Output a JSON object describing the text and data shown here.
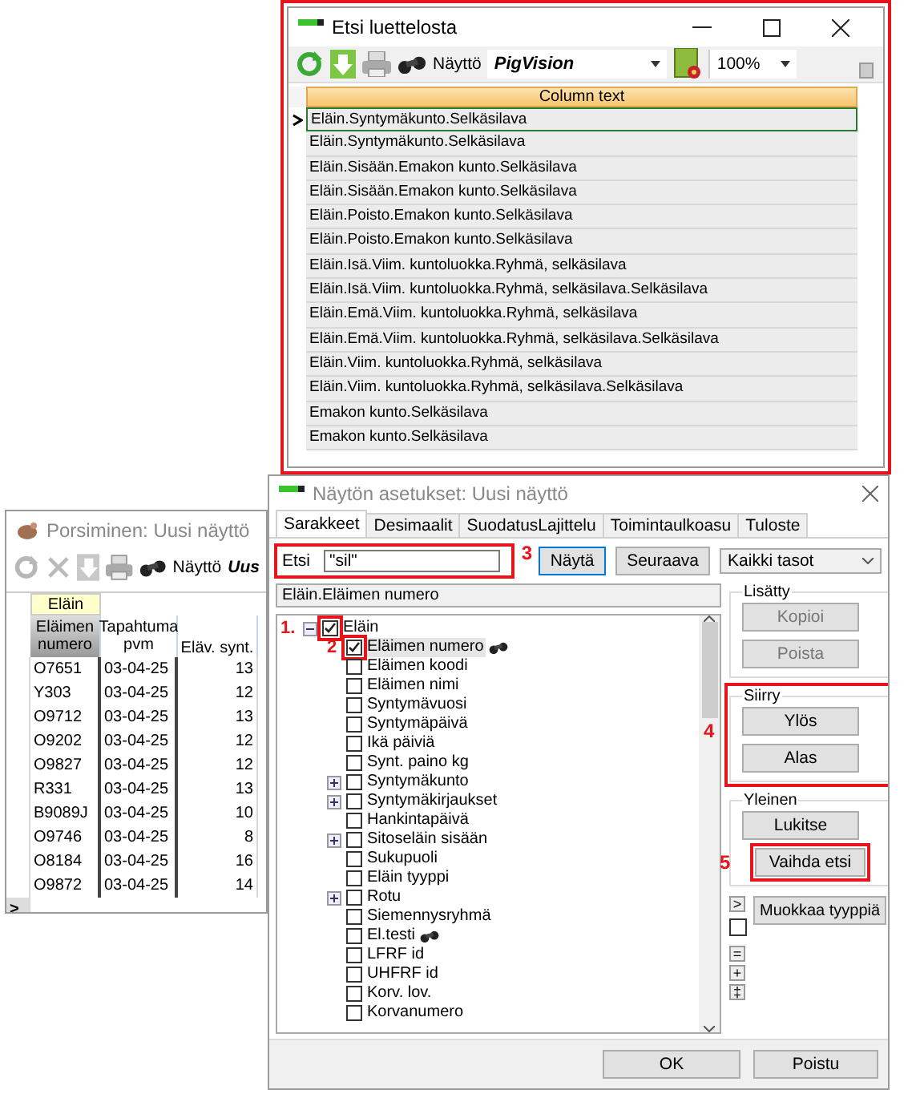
{
  "search_window": {
    "title": "Etsi luettelosta",
    "marked": true,
    "toolbar": {
      "view_label": "Näyttö",
      "view_value": "PigVision",
      "zoom": "100%"
    },
    "grid": {
      "column": "Column text",
      "rows": [
        {
          "text": "Eläin.Syntymäkunto.Selkäsilava",
          "selected": true
        },
        {
          "text": "Eläin.Syntymäkunto.Selkäsilava",
          "selected": false
        },
        {
          "text": "Eläin.Sisään.Emakon kunto.Selkäsilava",
          "selected": false
        },
        {
          "text": "Eläin.Sisään.Emakon kunto.Selkäsilava",
          "selected": false
        },
        {
          "text": "Eläin.Poisto.Emakon kunto.Selkäsilava",
          "selected": false
        },
        {
          "text": "Eläin.Poisto.Emakon kunto.Selkäsilava",
          "selected": false
        },
        {
          "text": "Eläin.Isä.Viim. kuntoluokka.Ryhmä, selkäsilava",
          "selected": false
        },
        {
          "text": "Eläin.Isä.Viim. kuntoluokka.Ryhmä, selkäsilava.Selkäsilava",
          "selected": false
        },
        {
          "text": "Eläin.Emä.Viim. kuntoluokka.Ryhmä, selkäsilava",
          "selected": false
        },
        {
          "text": "Eläin.Emä.Viim. kuntoluokka.Ryhmä, selkäsilava.Selkäsilava",
          "selected": false
        },
        {
          "text": "Eläin.Viim. kuntoluokka.Ryhmä, selkäsilava",
          "selected": false
        },
        {
          "text": "Eläin.Viim. kuntoluokka.Ryhmä, selkäsilava.Selkäsilava",
          "selected": false
        },
        {
          "text": "Emakon kunto.Selkäsilava",
          "selected": false
        },
        {
          "text": "Emakon kunto.Selkäsilava",
          "selected": false
        }
      ]
    }
  },
  "farrowing_window": {
    "title": "Porsiminen: Uusi näyttö",
    "toolbar": {
      "view_label": "Näyttö",
      "view_value": "Uus"
    },
    "group_header": "Eläin",
    "columns": [
      "Eläimen numero",
      "Tapahtuma pvm",
      "Eläv. synt."
    ],
    "rows": [
      [
        "O7651",
        "03-04-25",
        "13"
      ],
      [
        "Y303",
        "03-04-25",
        "12"
      ],
      [
        "O9712",
        "03-04-25",
        "13"
      ],
      [
        "O9202",
        "03-04-25",
        "12"
      ],
      [
        "O9827",
        "03-04-25",
        "12"
      ],
      [
        "R331",
        "03-04-25",
        "13"
      ],
      [
        "B9089J",
        "03-04-25",
        "10"
      ],
      [
        "O9746",
        "03-04-25",
        "8"
      ],
      [
        "O8184",
        "03-04-25",
        "16"
      ],
      [
        "O9872",
        "03-04-25",
        "14"
      ]
    ],
    "new_row_marker": ">"
  },
  "dialog": {
    "title": "Näytön asetukset: Uusi näyttö",
    "tabs": [
      {
        "label": "Sarakkeet",
        "selected": true
      },
      {
        "label": "Desimaalit",
        "selected": false
      },
      {
        "label": "SuodatusLajittelu",
        "selected": false
      },
      {
        "label": "Toimintaulkoasu",
        "selected": false
      },
      {
        "label": "Tuloste",
        "selected": false
      }
    ],
    "search": {
      "label": "Etsi",
      "value": "\"sil\"",
      "marker": "3"
    },
    "show_button": "Näytä",
    "next_button": "Seuraava",
    "level_dropdown": "Kaikki tasot",
    "path": "Eläin.Eläimen numero",
    "tree": [
      {
        "label": "Eläin",
        "checked": true,
        "expanded": true,
        "marker": "1.",
        "children": [
          {
            "label": "Eläimen numero",
            "checked": true,
            "selected": true,
            "flagged": true,
            "marker": "2"
          },
          {
            "label": "Eläimen koodi",
            "checked": false
          },
          {
            "label": "Eläimen nimi",
            "checked": false
          },
          {
            "label": "Syntymävuosi",
            "checked": false
          },
          {
            "label": "Syntymäpäivä",
            "checked": false
          },
          {
            "label": "Ikä päiviä",
            "checked": false
          },
          {
            "label": "Synt. paino kg",
            "checked": false
          },
          {
            "label": "Syntymäkunto",
            "checked": false,
            "expanded": false
          },
          {
            "label": "Syntymäkirjaukset",
            "checked": false,
            "expanded": false
          },
          {
            "label": "Hankintapäivä",
            "checked": false
          },
          {
            "label": "Sitoseläin sisään",
            "checked": false,
            "expanded": false
          },
          {
            "label": "Sukupuoli",
            "checked": false
          },
          {
            "label": "Eläin tyyppi",
            "checked": false
          },
          {
            "label": "Rotu",
            "checked": false,
            "expanded": false
          },
          {
            "label": "Siemennysryhmä",
            "checked": false
          },
          {
            "label": "El.testi",
            "checked": false,
            "flagged": true
          },
          {
            "label": "LFRF id",
            "checked": false
          },
          {
            "label": "UHFRF id",
            "checked": false
          },
          {
            "label": "Korv. lov.",
            "checked": false
          },
          {
            "label": "Korvanumero",
            "checked": false
          }
        ]
      }
    ],
    "groups": [
      {
        "title": "Lisätty",
        "buttons": [
          {
            "label": "Kopioi",
            "disabled": true
          },
          {
            "label": "Poista",
            "disabled": true
          }
        ]
      },
      {
        "title": "Siirry",
        "marker": "4",
        "buttons": [
          {
            "label": "Ylös",
            "disabled": false
          },
          {
            "label": "Alas",
            "disabled": false
          }
        ]
      },
      {
        "title": "Yleinen",
        "buttons": [
          {
            "label": "Lukitse",
            "disabled": false
          },
          {
            "label": "Vaihda etsi",
            "disabled": false,
            "marker": "5"
          }
        ]
      }
    ],
    "edit_type_button": "Muokkaa tyyppiä",
    "small_buttons": [
      {
        "kind": "button",
        "label": ">"
      },
      {
        "kind": "checkbox",
        "checked": false
      },
      {
        "kind": "button",
        "label": "="
      },
      {
        "kind": "button",
        "label": "+"
      },
      {
        "kind": "button",
        "label": "‡"
      }
    ],
    "footer_buttons": [
      "OK",
      "Poistu"
    ]
  }
}
